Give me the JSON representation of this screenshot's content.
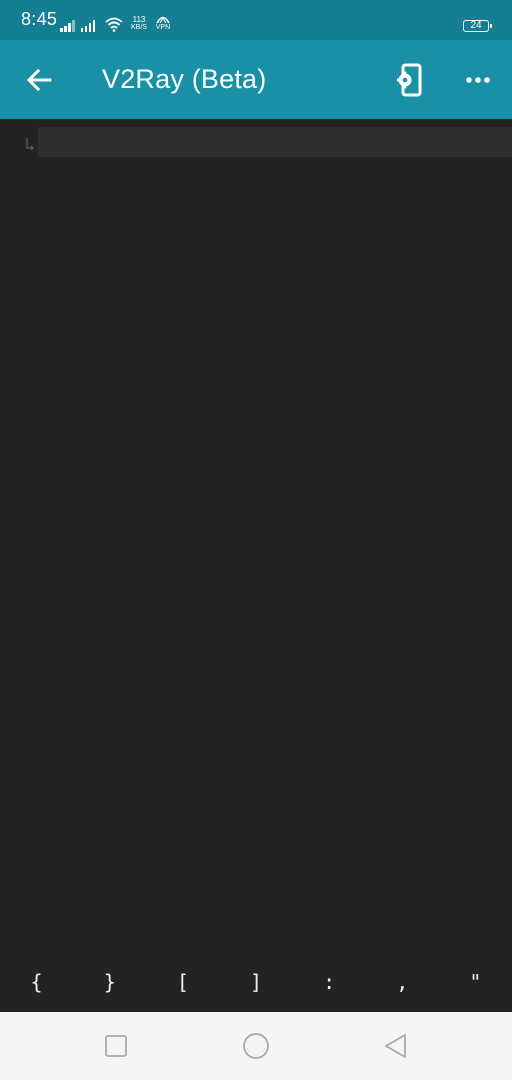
{
  "status_bar": {
    "time": "8:45",
    "net_speed_value": "113",
    "net_speed_unit": "KB/S",
    "vpn_label": "VPN",
    "battery_level": "24",
    "icons": [
      "signal-bars-icon",
      "signal-bars-icon",
      "wifi-icon",
      "net-speed-indicator",
      "vpn-icon",
      "battery-icon"
    ]
  },
  "toolbar": {
    "title": "V2Ray (Beta)",
    "back_icon": "arrow-back-icon",
    "settings_icon": "phone-settings-icon",
    "more_icon": "more-horizontal-icon",
    "background_color": "#1a90a6"
  },
  "editor": {
    "content": "",
    "gutter_icon": "line-wrap-icon",
    "background_color": "#232323"
  },
  "symbol_bar": {
    "keys": [
      "{",
      "}",
      "[",
      "]",
      ":",
      ",",
      "\""
    ]
  },
  "nav_bar": {
    "icons": [
      "square-recents-icon",
      "circle-home-icon",
      "triangle-back-icon"
    ]
  },
  "colors": {
    "status_bar": "#147e92",
    "toolbar": "#1a90a6",
    "editor_bg": "#232323",
    "active_line": "#2e2e2e",
    "nav_bg": "#f5f5f5"
  }
}
